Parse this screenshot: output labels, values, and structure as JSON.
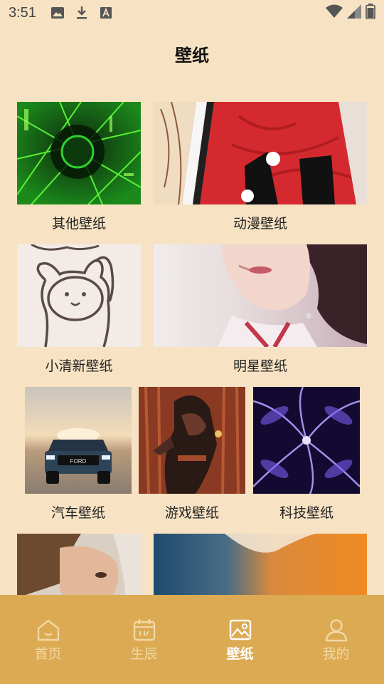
{
  "status_bar": {
    "time": "3:51",
    "icons": [
      "image-icon",
      "download-icon",
      "a-box-icon"
    ],
    "right_icons": [
      "wifi-icon",
      "signal-icon",
      "battery-icon"
    ]
  },
  "page": {
    "title": "壁纸"
  },
  "categories": [
    {
      "label": "其他壁纸",
      "image": "green-abstract"
    },
    {
      "label": "动漫壁纸",
      "image": "red-anime-jersey"
    },
    {
      "label": "小清新壁纸",
      "image": "bear-doodle"
    },
    {
      "label": "明星壁纸",
      "image": "woman-portrait"
    },
    {
      "label": "汽车壁纸",
      "image": "pickup-truck"
    },
    {
      "label": "游戏壁纸",
      "image": "game-fighter"
    },
    {
      "label": "科技壁纸",
      "image": "purple-fractal"
    },
    {
      "label": "",
      "image": "girl-portrait"
    },
    {
      "label": "",
      "image": "fox-fur"
    }
  ],
  "bottom_nav": {
    "items": [
      {
        "label": "首页",
        "icon": "home-icon",
        "active": false
      },
      {
        "label": "生辰",
        "icon": "calendar-icon",
        "active": false
      },
      {
        "label": "壁纸",
        "icon": "picture-icon",
        "active": true
      },
      {
        "label": "我的",
        "icon": "profile-icon",
        "active": false
      }
    ]
  },
  "colors": {
    "background": "#f7e3c3",
    "nav_bar": "#dcaa52",
    "nav_active": "#ffffff",
    "nav_inactive": "#f1d8a6"
  }
}
